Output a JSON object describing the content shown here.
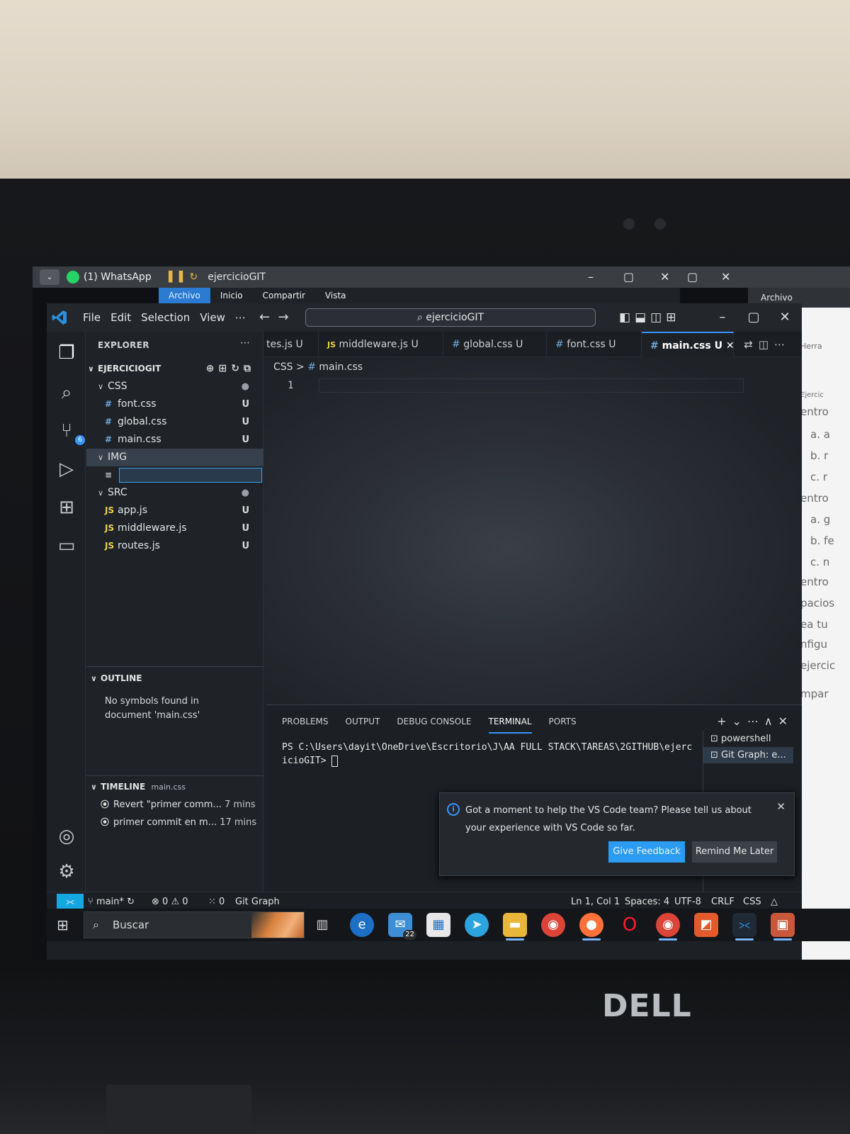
{
  "explorer_window": {
    "whatsapp_tab": "(1) WhatsApp",
    "folder_title": "ejercicioGIT",
    "ribbon_tabs": [
      "Archivo",
      "Inicio",
      "Compartir",
      "Vista"
    ],
    "right_window_ribbon": "Archivo",
    "right_window_doc_lines": [
      "Herra",
      "Ejercic",
      "entro",
      "a.  a",
      "b.  r",
      "c.  r",
      "entro",
      "a.  g",
      "b.  fe",
      "c.  n",
      "entro",
      "pacios",
      "ea tu",
      "nfigu",
      "ejercic",
      "mpar"
    ]
  },
  "vscode": {
    "menu": [
      "File",
      "Edit",
      "Selection",
      "View",
      "⋯"
    ],
    "command_center": "ejercicioGIT",
    "explorer_title": "EXPLORER",
    "root_folder": "EJERCICIOGIT",
    "tree": [
      {
        "name": "CSS",
        "kind": "folder",
        "deco": "●"
      },
      {
        "name": "font.css",
        "kind": "css",
        "deco": "U"
      },
      {
        "name": "global.css",
        "kind": "css",
        "deco": "U"
      },
      {
        "name": "main.css",
        "kind": "css",
        "deco": "U"
      },
      {
        "name": "IMG",
        "kind": "folder",
        "deco": ""
      },
      {
        "name": "",
        "kind": "new-file",
        "deco": ""
      },
      {
        "name": "SRC",
        "kind": "folder",
        "deco": "●"
      },
      {
        "name": "app.js",
        "kind": "js",
        "deco": "U"
      },
      {
        "name": "middleware.js",
        "kind": "js",
        "deco": "U"
      },
      {
        "name": "routes.js",
        "kind": "js",
        "deco": "U"
      }
    ],
    "outline": {
      "title": "OUTLINE",
      "empty": "No symbols found in document 'main.css'"
    },
    "timeline": {
      "title": "TIMELINE",
      "file": "main.css",
      "items": [
        {
          "text": "Revert \"primer comm...",
          "time": "7 mins"
        },
        {
          "text": "primer commit en m...",
          "time": "17 mins"
        }
      ]
    },
    "tabs": [
      {
        "label": "tes.js U",
        "icon": ""
      },
      {
        "label": "middleware.js U",
        "icon": "JS"
      },
      {
        "label": "global.css U",
        "icon": "#"
      },
      {
        "label": "font.css U",
        "icon": "#"
      },
      {
        "label": "main.css U",
        "icon": "#"
      }
    ],
    "breadcrumb": {
      "folder": "CSS",
      "sep": ">",
      "file": "main.css"
    },
    "line_number": "1",
    "panel": {
      "tabs": [
        "PROBLEMS",
        "OUTPUT",
        "DEBUG CONSOLE",
        "TERMINAL",
        "PORTS"
      ],
      "terminal_text": "PS C:\\Users\\dayit\\OneDrive\\Escritorio\\J\\AA FULL STACK\\TAREAS\\2GITHUB\\ejercicioGIT>",
      "terminals": [
        "powershell",
        "Git Graph: e..."
      ]
    },
    "notification": {
      "message": "Got a moment to help the VS Code team? Please tell us about your experience with VS Code so far.",
      "primary": "Give Feedback",
      "secondary": "Remind Me Later"
    },
    "status": {
      "branch": "main*",
      "errors": "0",
      "warnings": "0",
      "ports": "0",
      "git_graph": "Git Graph",
      "position": "Ln 1, Col 1",
      "spaces": "Spaces: 4",
      "encoding": "UTF-8",
      "eol": "CRLF",
      "language": "CSS"
    }
  },
  "taskbar": {
    "search": "Buscar",
    "mail_badge": "22",
    "apps": [
      "task-view",
      "edge",
      "mail",
      "store",
      "telegram",
      "file-explorer",
      "chrome",
      "firefox",
      "opera",
      "chrome-profile",
      "office",
      "vscode",
      "app"
    ]
  },
  "laptop_brand": "DELL",
  "colors": {
    "accent": "#3794ff",
    "feedback_button": "#2b9cf2",
    "remote": "#16a7e0",
    "whatsapp": "#25d366"
  }
}
